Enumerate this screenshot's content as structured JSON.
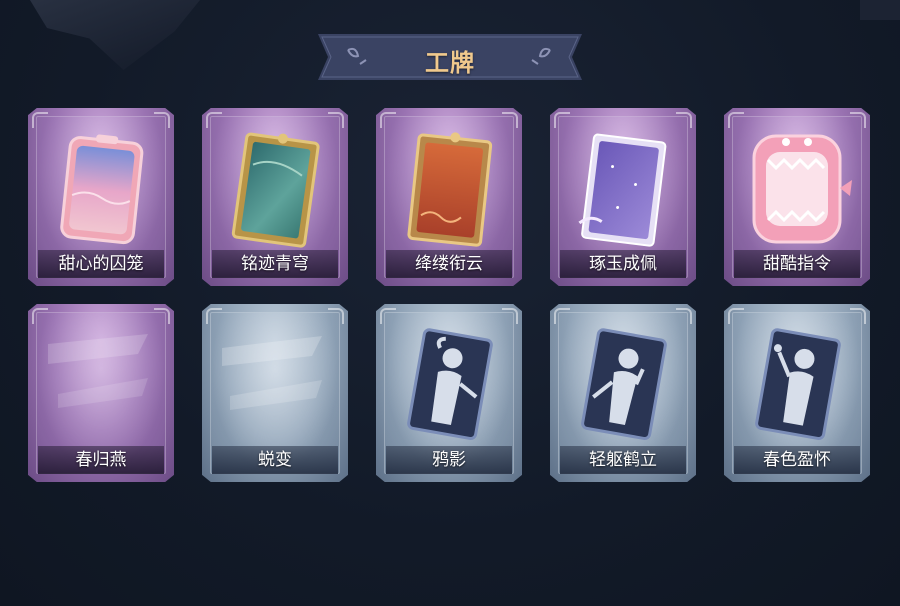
{
  "header": {
    "title": "工牌"
  },
  "colors": {
    "background": "#121a28",
    "title_gold": "#f0c98d",
    "banner": "#3a4363",
    "rare_frame": "#9a73b2",
    "common_frame": "#8fa2b6"
  },
  "cards": [
    {
      "label": "甜心的囚笼",
      "rarity": "purple",
      "art": "pink-sunset-frame-icon",
      "owned": true
    },
    {
      "label": "铭迹青穹",
      "rarity": "purple",
      "art": "teal-gold-frame-icon",
      "owned": true
    },
    {
      "label": "绛缕衔云",
      "rarity": "purple",
      "art": "red-orange-frame-icon",
      "owned": true
    },
    {
      "label": "琢玉成佩",
      "rarity": "purple",
      "art": "violet-jade-frame-icon",
      "owned": true
    },
    {
      "label": "甜酷指令",
      "rarity": "purple",
      "art": "pink-shark-frame-icon",
      "owned": true
    },
    {
      "label": "春归燕",
      "rarity": "purple",
      "art": "blank-card-icon",
      "owned": false
    },
    {
      "label": "蜕变",
      "rarity": "blue",
      "art": "blank-card-icon",
      "owned": false
    },
    {
      "label": "鸦影",
      "rarity": "blue",
      "art": "silhouette-card-icon",
      "owned": false
    },
    {
      "label": "轻躯鹤立",
      "rarity": "blue",
      "art": "silhouette-card-icon",
      "owned": false
    },
    {
      "label": "春色盈怀",
      "rarity": "blue",
      "art": "silhouette-card-icon",
      "owned": false
    }
  ]
}
